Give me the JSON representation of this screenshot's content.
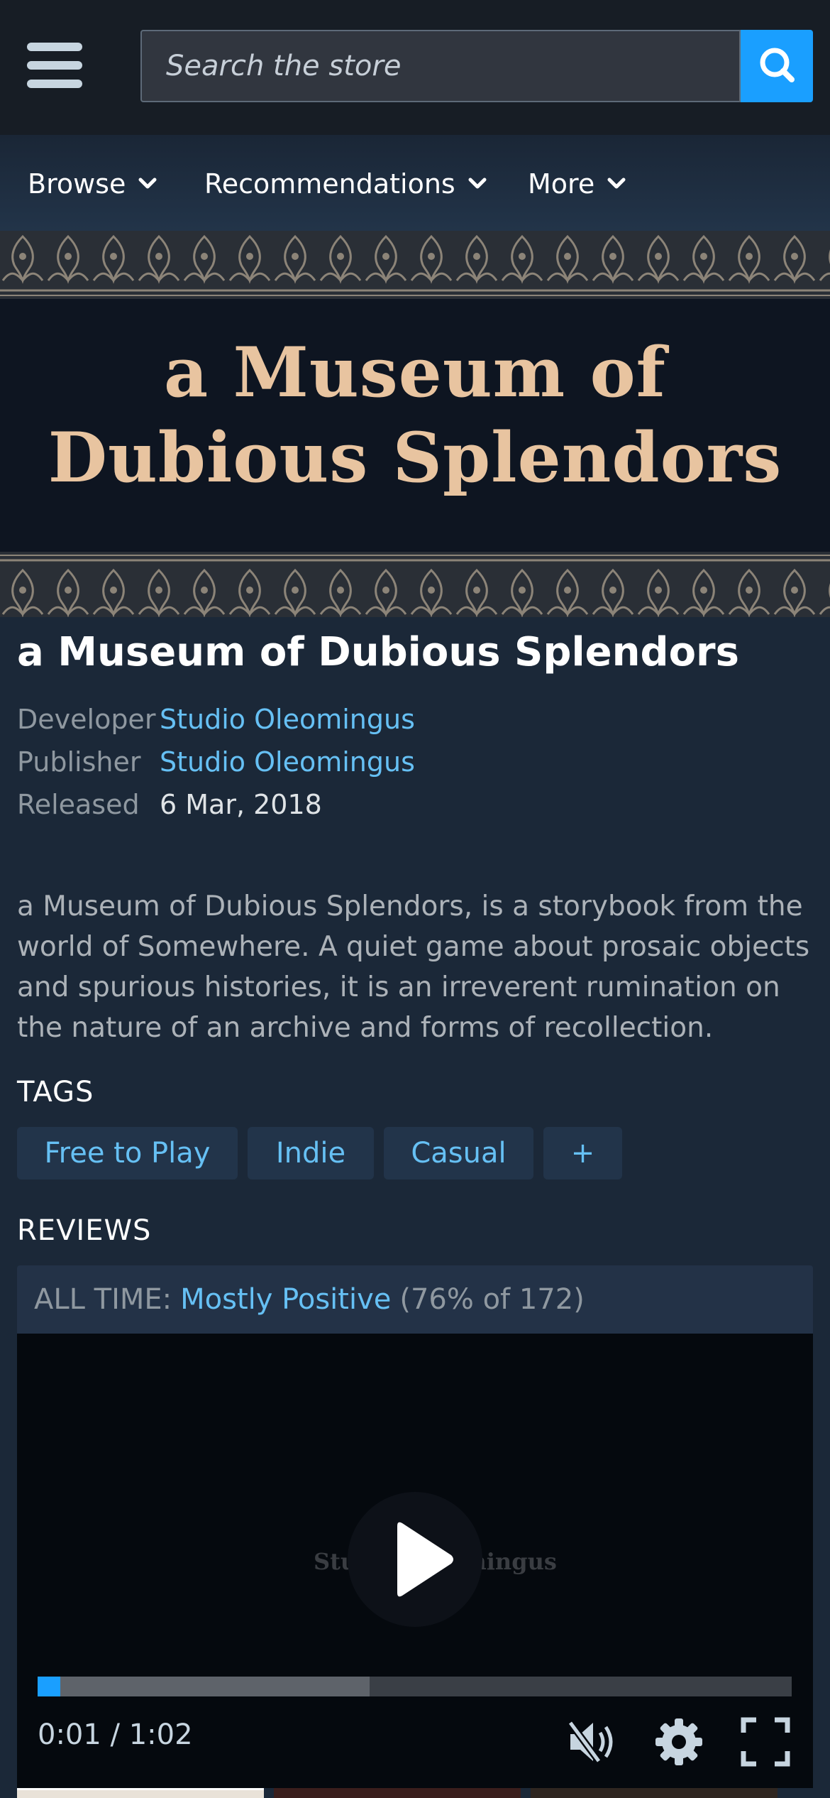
{
  "search": {
    "placeholder": "Search the store"
  },
  "nav": {
    "items": [
      {
        "label": "Browse"
      },
      {
        "label": "Recommendations"
      },
      {
        "label": "More"
      }
    ]
  },
  "banner": {
    "line1": "a Museum of",
    "line2": "Dubious Splendors"
  },
  "game": {
    "title": "a Museum of Dubious Splendors",
    "developer_label": "Developer",
    "developer": "Studio Oleomingus",
    "publisher_label": "Publisher",
    "publisher": "Studio Oleomingus",
    "released_label": "Released",
    "released": "6 Mar, 2018",
    "description": "a Museum of Dubious Splendors, is a storybook from the world of Somewhere. A quiet game about prosaic objects and spurious histories, it is an irreverent rumination on the nature of an archive and forms of recollection."
  },
  "tags": {
    "heading": "TAGS",
    "items": [
      "Free to Play",
      "Indie",
      "Casual",
      "+"
    ]
  },
  "reviews": {
    "heading": "REVIEWS",
    "label": "ALL TIME:",
    "rating": "Mostly Positive",
    "detail": "(76% of 172)"
  },
  "video": {
    "logo_text": "Studio Oleomingus",
    "time": "0:01 / 1:02",
    "progress": 0.03,
    "buffered": 0.44
  },
  "colors": {
    "accent": "#1a9fff",
    "link": "#66c0f4",
    "banner_text": "#e8c4a0",
    "background": "#1b2838"
  },
  "icons": [
    "hamburger-menu-icon",
    "search-icon",
    "chevron-down-icon",
    "play-icon",
    "mute-icon",
    "gear-icon",
    "fullscreen-icon"
  ]
}
